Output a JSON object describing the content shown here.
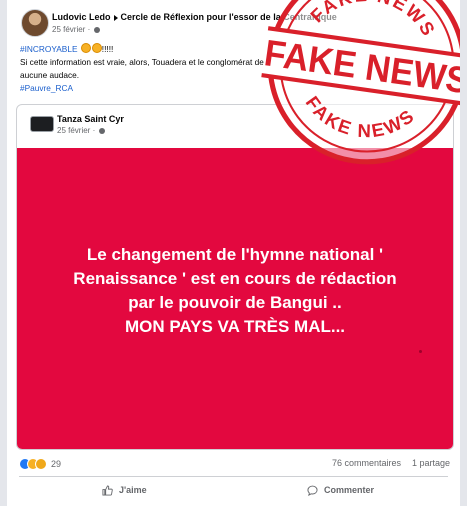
{
  "post": {
    "author": "Ludovic Ledo",
    "group": "Cercle de Réflexion pour l'essor de la Centrafrique",
    "date": "25 février",
    "hashtag1": "#INCROYABLE",
    "exclaim": "!!!!!",
    "body": "Si cette information est vraie, alors, Touadera et le conglomérat des incapables qui l'entoure ne reculent plus devant aucune audace.",
    "hashtag2": "#Pauvre_RCA"
  },
  "shared": {
    "author": "Tanza Saint Cyr",
    "date": "25 février",
    "lines": [
      "Le changement de l'hymne national '",
      "Renaissance ' est en cours de rédaction",
      "par le pouvoir de Bangui ..",
      "MON PAYS VA TRÈS MAL..."
    ]
  },
  "stats": {
    "reactions": "29",
    "comments": "76 commentaires",
    "shares": "1 partage"
  },
  "actions": {
    "like": "J'aime",
    "comment": "Commenter"
  },
  "stamp": {
    "arc_text": "FAKE NEWS",
    "main_text": "FAKE NEWS",
    "color": "#d9202a"
  },
  "colors": {
    "panel_red": "#e3083f",
    "link_blue": "#1b5fcc"
  }
}
